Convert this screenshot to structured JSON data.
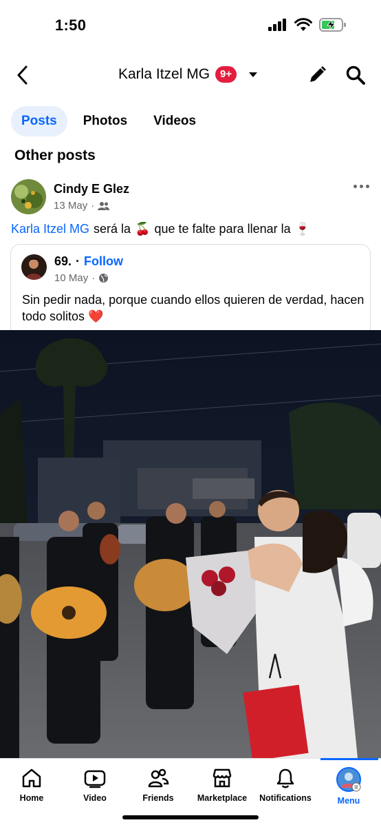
{
  "status_bar": {
    "time": "1:50",
    "battery_color": "#34c759"
  },
  "header": {
    "title": "Karla Itzel MG",
    "badge": "9+",
    "back_icon": "chevron-left-icon",
    "edit_icon": "pencil-icon",
    "search_icon": "search-icon"
  },
  "tabs": [
    {
      "label": "Posts",
      "active": true
    },
    {
      "label": "Photos",
      "active": false
    },
    {
      "label": "Videos",
      "active": false
    }
  ],
  "section_title": "Other posts",
  "post": {
    "author": "Cindy E Glez",
    "date": "13 May",
    "dot": "·",
    "audience_icon": "friends-icon",
    "text_mention": "Karla Itzel MG",
    "text_part1": "será la",
    "emoji_cherries": "🍒",
    "text_part2": "que te falte para llenar la",
    "emoji_wine": "🍷",
    "shared": {
      "author": "69.",
      "separator": "·",
      "follow": "Follow",
      "date": "10 May",
      "dot": "·",
      "audience_icon": "globe-icon",
      "text": "Sin pedir nada, porque cuando ellos quieren de verdad, hacen todo solitos ❤️"
    }
  },
  "bottom_nav": [
    {
      "label": "Home",
      "icon": "home-icon",
      "active": false
    },
    {
      "label": "Video",
      "icon": "video-icon",
      "active": false
    },
    {
      "label": "Friends",
      "icon": "friends-icon",
      "active": false
    },
    {
      "label": "Marketplace",
      "icon": "marketplace-icon",
      "active": false
    },
    {
      "label": "Notifications",
      "icon": "bell-icon",
      "active": false
    },
    {
      "label": "Menu",
      "icon": "profile-avatar-icon",
      "active": true
    }
  ],
  "colors": {
    "accent": "#0866ff",
    "badge": "#e41e3f",
    "secondary_text": "#65676b"
  }
}
